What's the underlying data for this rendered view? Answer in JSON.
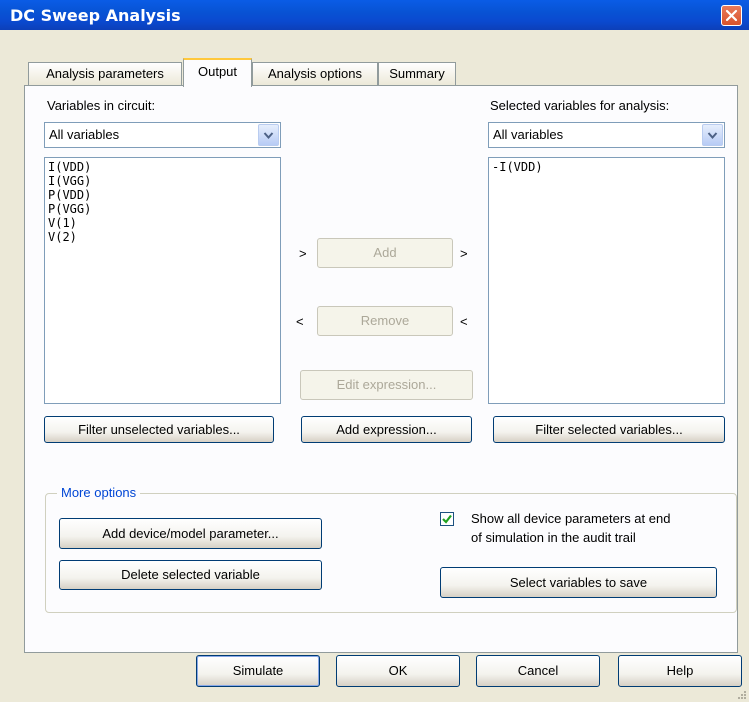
{
  "window": {
    "title": "DC Sweep Analysis"
  },
  "tabs": [
    {
      "label": "Analysis parameters",
      "active": false
    },
    {
      "label": "Output",
      "active": true
    },
    {
      "label": "Analysis options",
      "active": false
    },
    {
      "label": "Summary",
      "active": false
    }
  ],
  "left": {
    "label": "Variables in circuit:",
    "combo_value": "All variables",
    "items": [
      "I(VDD)",
      "I(VGG)",
      "P(VDD)",
      "P(VGG)",
      "V(1)",
      "V(2)"
    ],
    "filter_button": "Filter unselected variables..."
  },
  "right": {
    "label": "Selected variables for analysis:",
    "combo_value": "All variables",
    "items": [
      "-I(VDD)"
    ],
    "filter_button": "Filter selected variables..."
  },
  "middle": {
    "add_button": "Add",
    "remove_button": "Remove",
    "edit_expression_button": "Edit expression...",
    "add_expression_button": "Add expression...",
    "chevron_right": ">",
    "chevron_left": "<"
  },
  "more_options": {
    "label": "More options",
    "add_device_button": "Add device/model parameter...",
    "delete_button": "Delete selected variable",
    "checkbox_line1": "Show all device parameters at end",
    "checkbox_line2": "of simulation in the audit trail",
    "checkbox_checked": true,
    "select_vars_button": "Select variables to save"
  },
  "footer": {
    "simulate": "Simulate",
    "ok": "OK",
    "cancel": "Cancel",
    "help": "Help"
  },
  "colors": {
    "titlebar": "#0853d4",
    "close": "#d9532c",
    "dialog_bg": "#ece9d8",
    "panel_bg": "#fcfcfe",
    "group_label": "#0046d5",
    "tab_highlight": "#ffc83c"
  }
}
